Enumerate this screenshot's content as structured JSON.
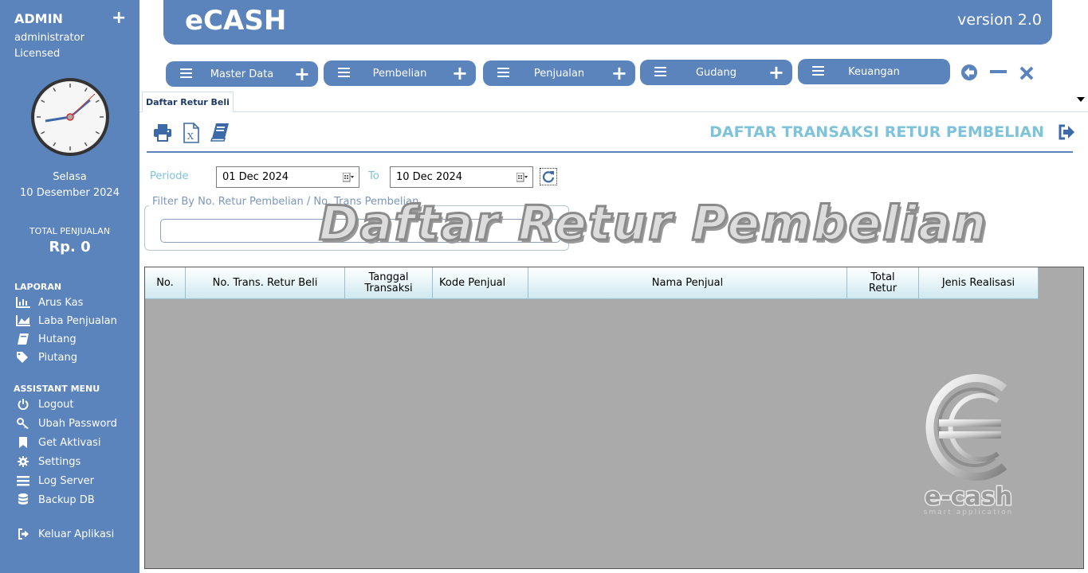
{
  "sidebar": {
    "admin": "ADMIN",
    "plus": "+",
    "role": "administrator",
    "license": "Licensed",
    "day": "Selasa",
    "date": "10 Desember 2024",
    "total_label": "TOTAL PENJUALAN",
    "total_value": "Rp. 0",
    "laporan_title": "LAPORAN",
    "laporan": [
      {
        "label": "Arus Kas",
        "icon": "bar-chart-icon"
      },
      {
        "label": "Laba Penjualan",
        "icon": "area-chart-icon"
      },
      {
        "label": "Hutang",
        "icon": "book-icon"
      },
      {
        "label": "Piutang",
        "icon": "tags-icon"
      }
    ],
    "assistant_title": "ASSISTANT MENU",
    "assistant": [
      {
        "label": "Logout",
        "icon": "power-icon"
      },
      {
        "label": "Ubah Password",
        "icon": "key-icon"
      },
      {
        "label": "Get Aktivasi",
        "icon": "bookmark-icon"
      },
      {
        "label": "Settings",
        "icon": "gear-icon"
      },
      {
        "label": "Log Server",
        "icon": "list-icon"
      },
      {
        "label": "Backup DB",
        "icon": "database-icon"
      }
    ],
    "exit": "Keluar Aplikasi"
  },
  "header": {
    "title": "eCASH",
    "version": "version 2.0"
  },
  "menus": [
    {
      "label": "Master Data",
      "has_plus": true
    },
    {
      "label": "Pembelian",
      "has_plus": true
    },
    {
      "label": "Penjualan",
      "has_plus": true
    },
    {
      "label": "Gudang",
      "has_plus": true
    },
    {
      "label": "Keuangan",
      "has_plus": false
    }
  ],
  "menu_plus": "+",
  "tab": {
    "label": "Daftar Retur Beli"
  },
  "page": {
    "title": "DAFTAR TRANSAKSI RETUR PEMBELIAN",
    "periode_label": "Periode",
    "date_from": "01 Dec  2024",
    "to_label": "To",
    "date_to": "10 Dec  2024",
    "filter_legend": "Filter By No. Retur Pembelian / No. Trans Pembelian",
    "filter_value": "",
    "watermark": "Daftar Retur Pembelian"
  },
  "table": {
    "columns": [
      "No.",
      "No. Trans. Retur Beli",
      "Tanggal Transaksi",
      "Kode Penjual",
      "Nama Penjual",
      "Total Retur",
      "Jenis Realisasi"
    ],
    "rows": []
  },
  "logo": {
    "text": "e-cash",
    "tagline": "smart application"
  },
  "colors": {
    "brand": "#5b84bd",
    "accent": "#7ec3d9",
    "grid_bg": "#aaaaaa"
  }
}
